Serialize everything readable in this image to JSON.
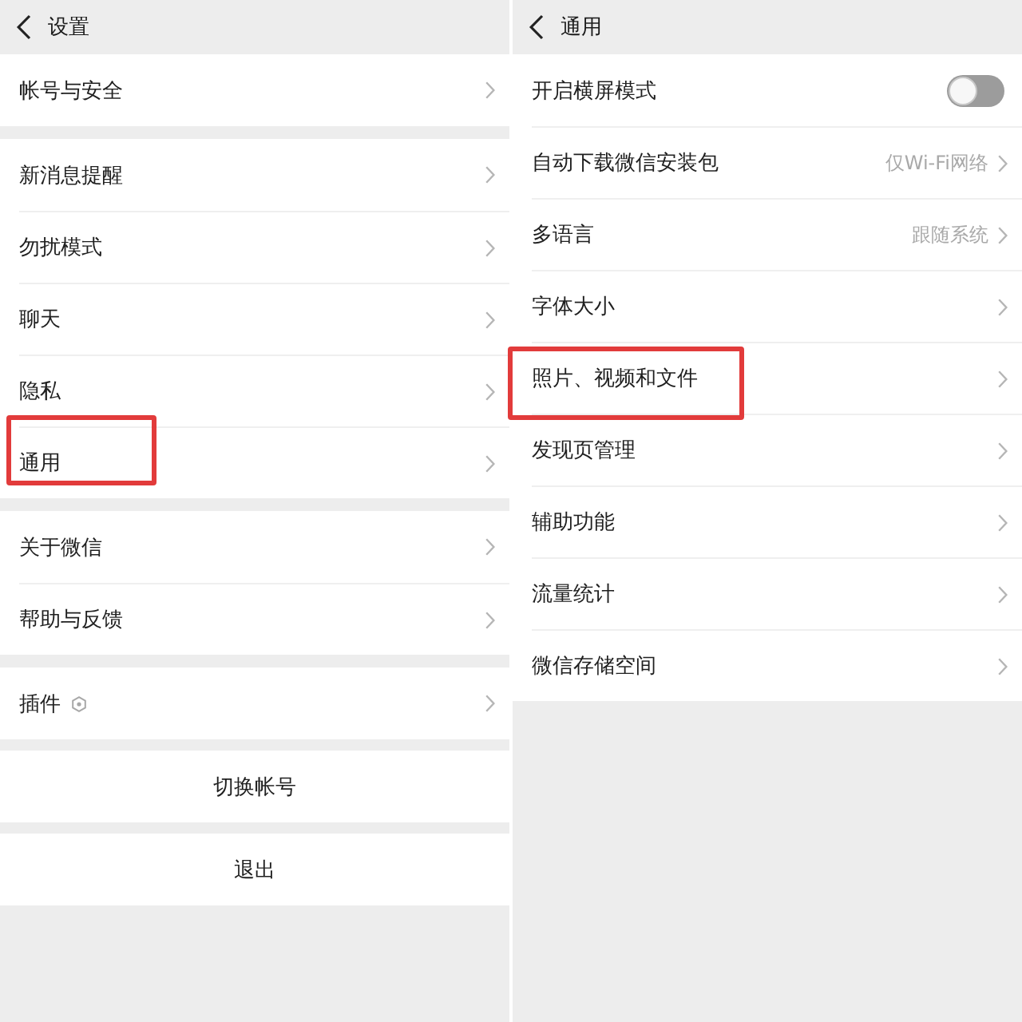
{
  "left_screen": {
    "header": {
      "title": "设置"
    },
    "groups": [
      {
        "items": [
          {
            "kind": "nav",
            "label": "帐号与安全",
            "highlighted": false
          }
        ]
      },
      {
        "items": [
          {
            "kind": "nav",
            "label": "新消息提醒",
            "highlighted": false
          },
          {
            "kind": "nav",
            "label": "勿扰模式",
            "highlighted": false
          },
          {
            "kind": "nav",
            "label": "聊天",
            "highlighted": false
          },
          {
            "kind": "nav",
            "label": "隐私",
            "highlighted": false
          },
          {
            "kind": "nav",
            "label": "通用",
            "highlighted": true
          }
        ]
      },
      {
        "items": [
          {
            "kind": "nav",
            "label": "关于微信",
            "highlighted": false
          },
          {
            "kind": "nav",
            "label": "帮助与反馈",
            "highlighted": false
          }
        ]
      },
      {
        "items": [
          {
            "kind": "nav-badge",
            "label": "插件",
            "highlighted": false
          }
        ]
      }
    ],
    "buttons": [
      "切换帐号",
      "退出"
    ]
  },
  "right_screen": {
    "header": {
      "title": "通用"
    },
    "items": [
      {
        "kind": "toggle",
        "label": "开启横屏模式",
        "on": false,
        "highlighted": false
      },
      {
        "kind": "nav",
        "label": "自动下载微信安装包",
        "value": "仅Wi-Fi网络",
        "highlighted": false
      },
      {
        "kind": "nav",
        "label": "多语言",
        "value": "跟随系统",
        "highlighted": false
      },
      {
        "kind": "nav",
        "label": "字体大小",
        "highlighted": false
      },
      {
        "kind": "nav",
        "label": "照片、视频和文件",
        "highlighted": true
      },
      {
        "kind": "nav",
        "label": "发现页管理",
        "highlighted": false
      },
      {
        "kind": "nav",
        "label": "辅助功能",
        "highlighted": false
      },
      {
        "kind": "nav",
        "label": "流量统计",
        "highlighted": false
      },
      {
        "kind": "nav",
        "label": "微信存储空间",
        "highlighted": false
      }
    ]
  }
}
